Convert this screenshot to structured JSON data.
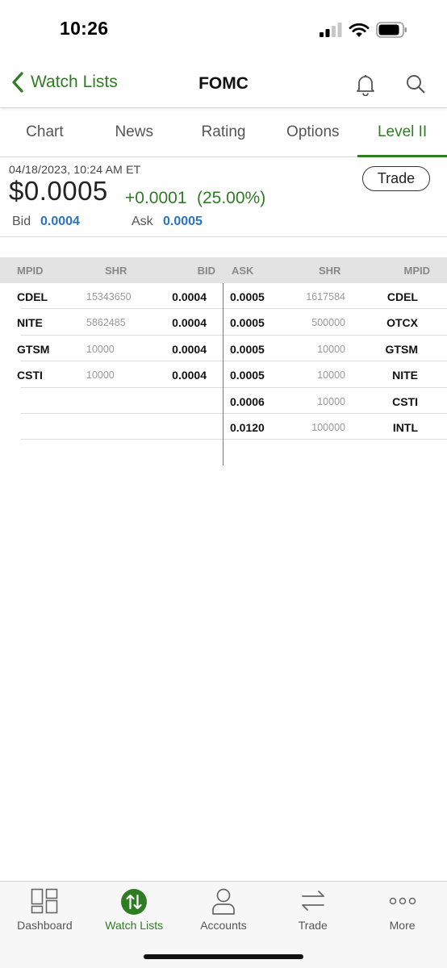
{
  "status": {
    "time": "10:26"
  },
  "nav": {
    "back_label": "Watch Lists",
    "title": "FOMC"
  },
  "tabs": [
    {
      "label": "Chart"
    },
    {
      "label": "News"
    },
    {
      "label": "Rating"
    },
    {
      "label": "Options"
    },
    {
      "label": "Level II",
      "active": true
    }
  ],
  "quote": {
    "timestamp": "04/18/2023, 10:24 AM ET",
    "price": "$0.0005",
    "change": "+0.0001",
    "change_pct": "(25.00%)",
    "bid_label": "Bid",
    "bid": "0.0004",
    "ask_label": "Ask",
    "ask": "0.0005",
    "trade_label": "Trade"
  },
  "level2": {
    "headers": {
      "bid_mpid": "MPID",
      "bid_shr": "SHR",
      "bid": "BID",
      "ask": "ASK",
      "ask_shr": "SHR",
      "ask_mpid": "MPID"
    },
    "rows": [
      {
        "bid_mpid": "CDEL",
        "bid_shr": "15343650",
        "bid": "0.0004",
        "ask": "0.0005",
        "ask_shr": "1617584",
        "ask_mpid": "CDEL"
      },
      {
        "bid_mpid": "NITE",
        "bid_shr": "5862485",
        "bid": "0.0004",
        "ask": "0.0005",
        "ask_shr": "500000",
        "ask_mpid": "OTCX"
      },
      {
        "bid_mpid": "GTSM",
        "bid_shr": "10000",
        "bid": "0.0004",
        "ask": "0.0005",
        "ask_shr": "10000",
        "ask_mpid": "GTSM"
      },
      {
        "bid_mpid": "CSTI",
        "bid_shr": "10000",
        "bid": "0.0004",
        "ask": "0.0005",
        "ask_shr": "10000",
        "ask_mpid": "NITE"
      },
      {
        "bid_mpid": "",
        "bid_shr": "",
        "bid": "",
        "ask": "0.0006",
        "ask_shr": "10000",
        "ask_mpid": "CSTI"
      },
      {
        "bid_mpid": "",
        "bid_shr": "",
        "bid": "",
        "ask": "0.0120",
        "ask_shr": "100000",
        "ask_mpid": "INTL"
      }
    ]
  },
  "tab_bar": [
    {
      "label": "Dashboard",
      "icon": "dashboard-icon"
    },
    {
      "label": "Watch Lists",
      "icon": "watch-lists-icon",
      "active": true
    },
    {
      "label": "Accounts",
      "icon": "accounts-icon"
    },
    {
      "label": "Trade",
      "icon": "trade-icon"
    },
    {
      "label": "More",
      "icon": "more-icon"
    }
  ],
  "colors": {
    "accent_green": "#2e7d22",
    "link_blue": "#2a73c5"
  }
}
